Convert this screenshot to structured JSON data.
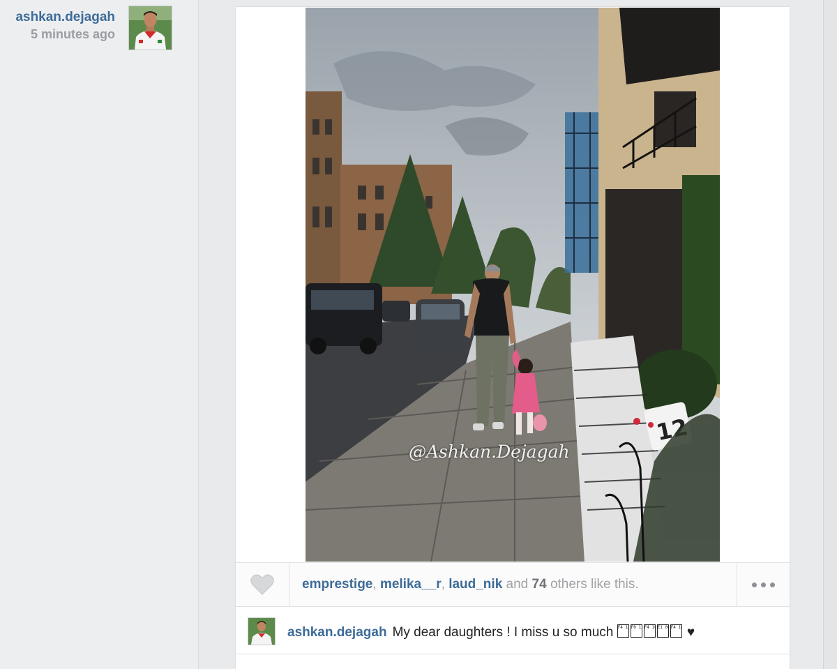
{
  "post": {
    "username": "ashkan.dejagah",
    "time_ago": "5 minutes ago"
  },
  "photo": {
    "watermark": "@Ashkan.Dejagah",
    "sign_number": "12"
  },
  "likes": {
    "users": [
      "emprestige",
      "melika__r",
      "laud_nik"
    ],
    "separator": ", ",
    "connector": " and ",
    "count": "74",
    "suffix": " others like this."
  },
  "comment": {
    "username": "ashkan.dejagah",
    "text": "My dear daughters ! I miss u so much",
    "glyphs": [
      "F4 13",
      "F0 12",
      "F4 10",
      "E1 06",
      "F4 18"
    ],
    "heart": "♥"
  },
  "icons": {
    "like": "heart-icon",
    "more": "more-options-icon"
  },
  "colors": {
    "link": "#3d6c98",
    "muted": "#9fa2a6",
    "background": "#e9eaec"
  }
}
